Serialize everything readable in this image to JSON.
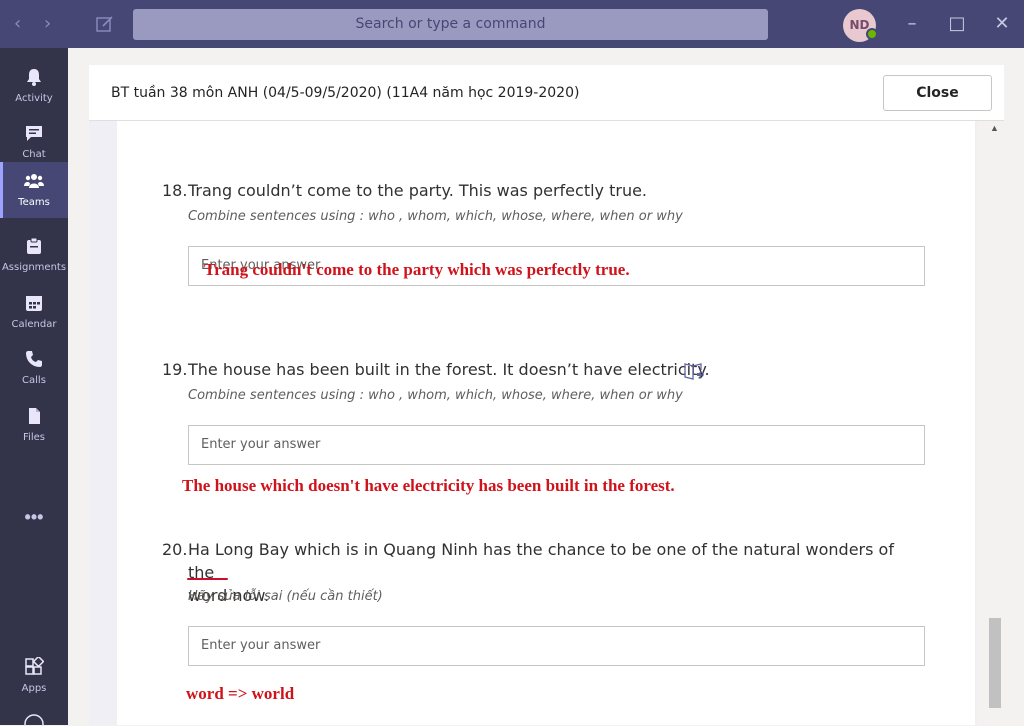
{
  "titlebar": {
    "search_placeholder": "Search or type a command",
    "avatar_initials": "ND",
    "back_icon": "chevron-left-icon",
    "forward_icon": "chevron-right-icon",
    "compose_icon": "compose-icon",
    "minimize_icon": "minimize-icon",
    "maximize_icon": "maximize-icon",
    "close_icon": "close-icon"
  },
  "rail": {
    "items": [
      {
        "label": "Activity",
        "icon": "bell-icon"
      },
      {
        "label": "Chat",
        "icon": "chat-icon"
      },
      {
        "label": "Teams",
        "icon": "teams-icon",
        "active": true
      },
      {
        "label": "Assignments",
        "icon": "assignments-icon"
      },
      {
        "label": "Calendar",
        "icon": "calendar-icon"
      },
      {
        "label": "Calls",
        "icon": "phone-icon"
      },
      {
        "label": "Files",
        "icon": "file-icon"
      }
    ],
    "more": "•••",
    "apps_label": "Apps"
  },
  "dialog": {
    "title": "BT tuần 38 môn ANH (04/5-09/5/2020) (11A4 năm học 2019-2020)",
    "close_label": "Close"
  },
  "questions": [
    {
      "number": "18.",
      "text": "Trang couldn’t come to the party. This was perfectly true.",
      "instruction": "Combine sentences using : who , whom, which, whose, where, when or why",
      "placeholder": "Enter your answer",
      "handwritten": "Trang couldn't come to the party which was perfectly true."
    },
    {
      "number": "19.",
      "text": "The house has been built in the forest. It doesn’t have electricity.",
      "instruction": "Combine sentences using : who , whom, which, whose, where, when or why",
      "placeholder": "Enter your answer",
      "handwritten": "The house which doesn't have electricity has been built in the forest."
    },
    {
      "number": "20.",
      "text_line1": "Ha Long Bay which is in Quang Ninh has the chance to be one of  the natural wonders of the",
      "text_word": "word",
      "text_line2_rest": " now.",
      "instruction": "Hãy sửa lỗi sai (nếu cần thiết)",
      "placeholder": "Enter your answer",
      "handwritten": "word => world"
    }
  ],
  "colors": {
    "titlebar": "#464775",
    "rail": "#33344a",
    "handwriting": "#d0131b"
  }
}
